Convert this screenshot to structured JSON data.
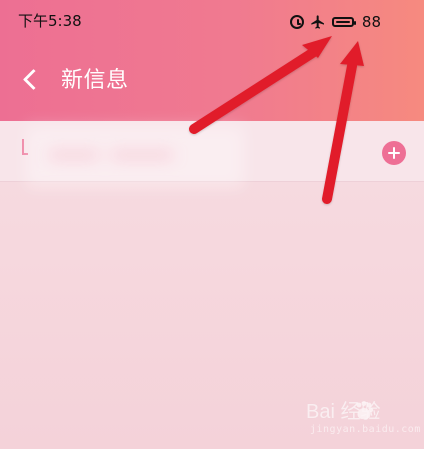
{
  "status_bar": {
    "time": "下午5:38",
    "icons": [
      "alarm-icon",
      "airplane-icon",
      "battery-icon"
    ],
    "battery_level": "88"
  },
  "header": {
    "title": "新信息",
    "back_icon": "chevron-left-icon"
  },
  "recipient": {
    "add_icon": "plus-icon"
  },
  "watermark": {
    "text": "Bai 经验",
    "subtext": "jingyan.baidu.com",
    "icon": "paw-icon"
  },
  "annotation": {
    "arrow_color": "#e11d2a",
    "arrows": 2
  },
  "colors": {
    "header_left": "#ed6f93",
    "header_right": "#f68a7f",
    "accent": "#ee6f95"
  }
}
